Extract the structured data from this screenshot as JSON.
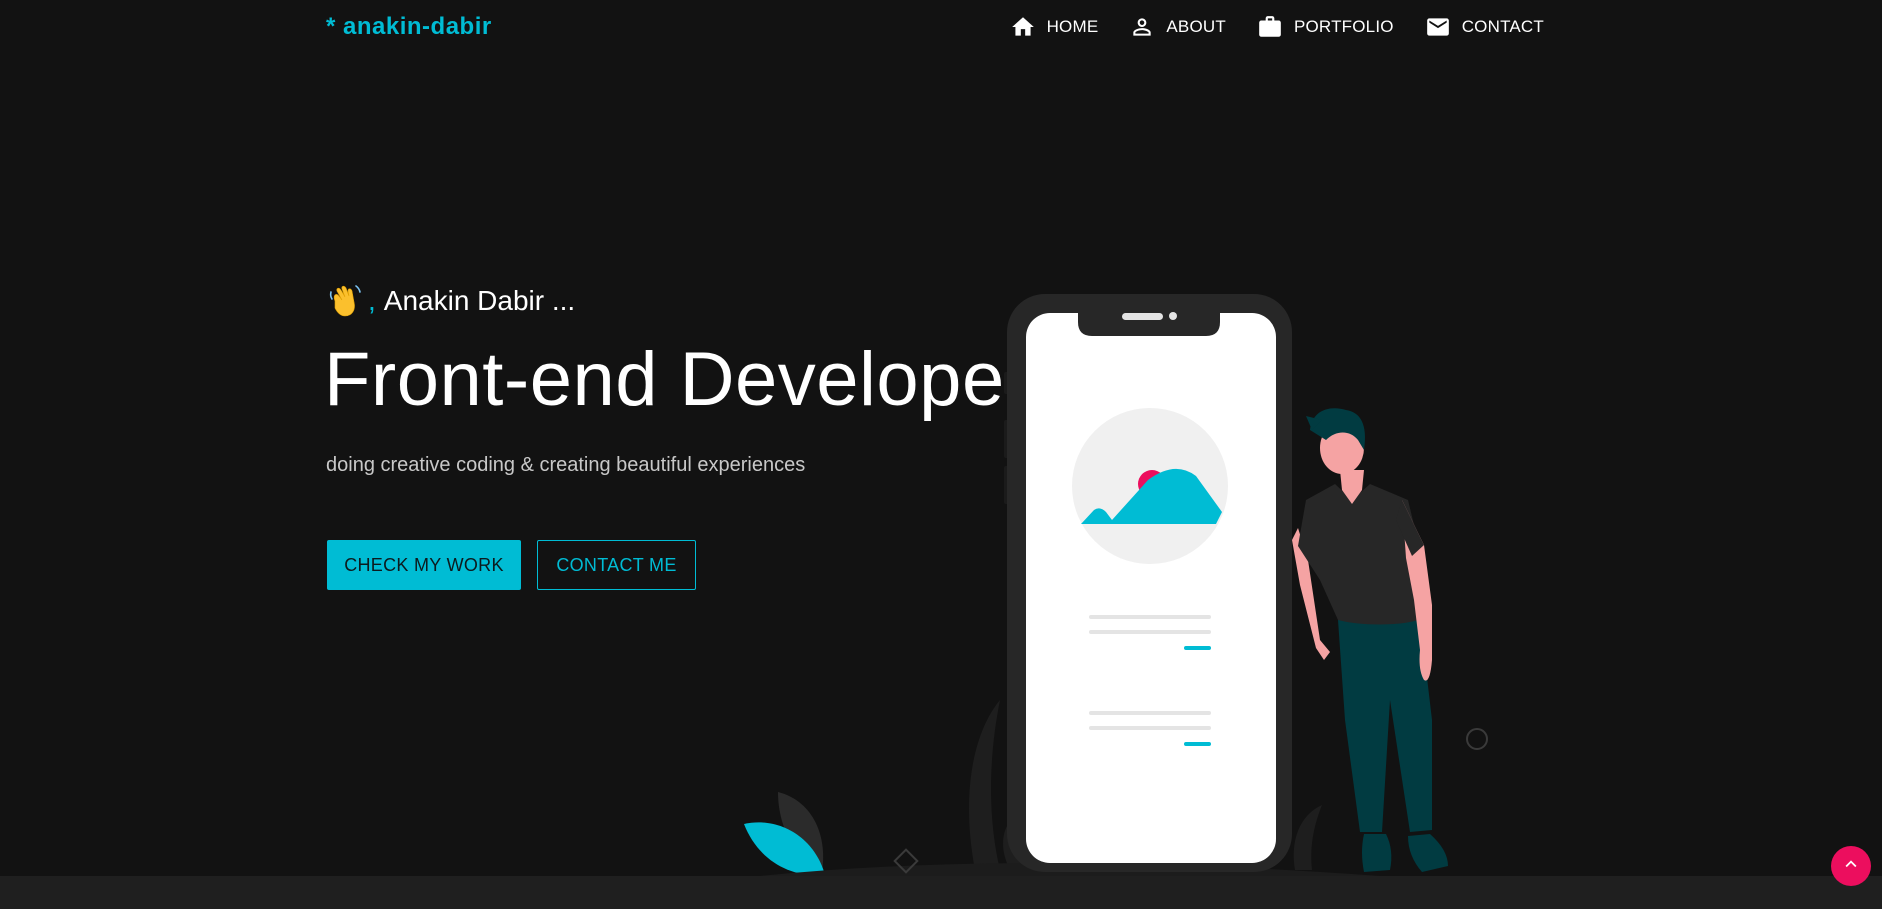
{
  "brand": {
    "text": "* anakin-dabir"
  },
  "nav": {
    "items": [
      {
        "label": "HOME",
        "icon": "home-icon"
      },
      {
        "label": "ABOUT",
        "icon": "person-icon"
      },
      {
        "label": "PORTFOLIO",
        "icon": "briefcase-icon"
      },
      {
        "label": "CONTACT",
        "icon": "mail-icon"
      }
    ]
  },
  "hero": {
    "greeting_icon": "waving-hand-icon",
    "greeting_comma": ",",
    "greeting_name": "Anakin Dabir ...",
    "headline": "Front-end Developer",
    "tagline": "doing creative coding & creating beautiful experiences",
    "primary_button": "CHECK MY WORK",
    "secondary_button": "CONTACT ME"
  },
  "scroll_top": {
    "icon": "chevron-up-icon"
  },
  "colors": {
    "background": "#121212",
    "accent": "#00bcd4",
    "pink": "#ec0e5e",
    "bottom_bar": "#1f1f1f"
  }
}
